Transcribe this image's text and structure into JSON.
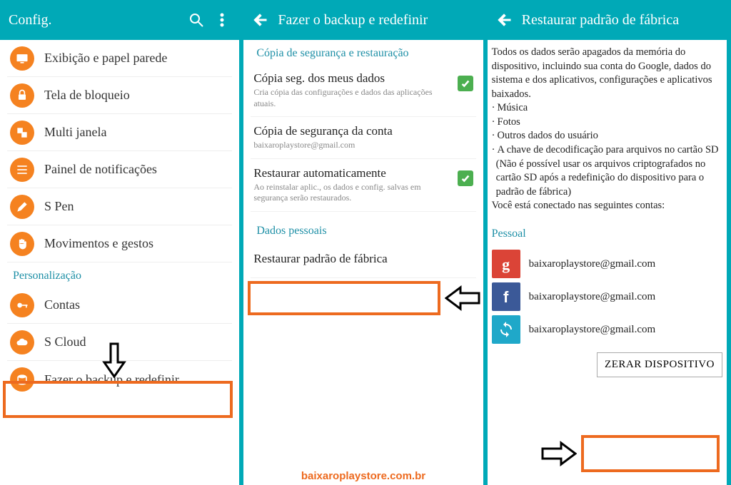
{
  "panel1": {
    "title": "Config.",
    "items": [
      {
        "label": "Exibição e papel parede",
        "icon": "display"
      },
      {
        "label": "Tela de bloqueio",
        "icon": "lock"
      },
      {
        "label": "Multi janela",
        "icon": "multiwindow"
      },
      {
        "label": "Painel de notificações",
        "icon": "list"
      },
      {
        "label": "S Pen",
        "icon": "pen"
      },
      {
        "label": "Movimentos e gestos",
        "icon": "hand"
      }
    ],
    "section": "Personalização",
    "subitems": [
      {
        "label": "Contas",
        "icon": "key"
      },
      {
        "label": "S Cloud",
        "icon": "cloud"
      },
      {
        "label": "Fazer o backup e redefinir",
        "icon": "backup"
      }
    ]
  },
  "panel2": {
    "title": "Fazer o backup e redefinir",
    "section1": "Cópia de segurança e restauração",
    "items": [
      {
        "title": "Cópia seg. dos meus dados",
        "sub": "Cria cópia das configurações e dados das aplicações atuais.",
        "checked": true
      },
      {
        "title": "Cópia de segurança da conta",
        "sub": "baixaroplaystore@gmail.com",
        "checked": false
      },
      {
        "title": "Restaurar automaticamente",
        "sub": "Ao reinstalar aplic., os dados e config. salvas em segurança serão restaurados.",
        "checked": true
      }
    ],
    "section2": "Dados pessoais",
    "reset_item": "Restaurar padrão de fábrica"
  },
  "panel3": {
    "title": "Restaurar padrão de fábrica",
    "intro": "Todos os dados serão apagados da memória do dispositivo, incluindo sua conta do Google, dados do sistema e dos aplicativos, configurações e aplicativos baixados.",
    "bullets": [
      "Música",
      "Fotos",
      "Outros dados do usuário",
      "A chave de decodificação para arquivos no cartão SD"
    ],
    "paren": "(Não é possível usar os arquivos criptografados no cartão SD após a redefinição do dispositivo para o padrão de fábrica)",
    "connected": "Você está conectado nas seguintes contas:",
    "accounts_header": "Pessoal",
    "accounts": [
      {
        "type": "google",
        "email": "baixaroplaystore@gmail.com",
        "bg": "#db4437",
        "letter": "g"
      },
      {
        "type": "facebook",
        "email": "baixaroplaystore@gmail.com",
        "bg": "#3b5998",
        "letter": "f"
      },
      {
        "type": "sync",
        "email": "baixaroplaystore@gmail.com",
        "bg": "#1fa8c9",
        "letter": "↻"
      }
    ],
    "button": "ZERAR DISPOSITIVO"
  },
  "watermark": "baixaroplaystore.com.br"
}
